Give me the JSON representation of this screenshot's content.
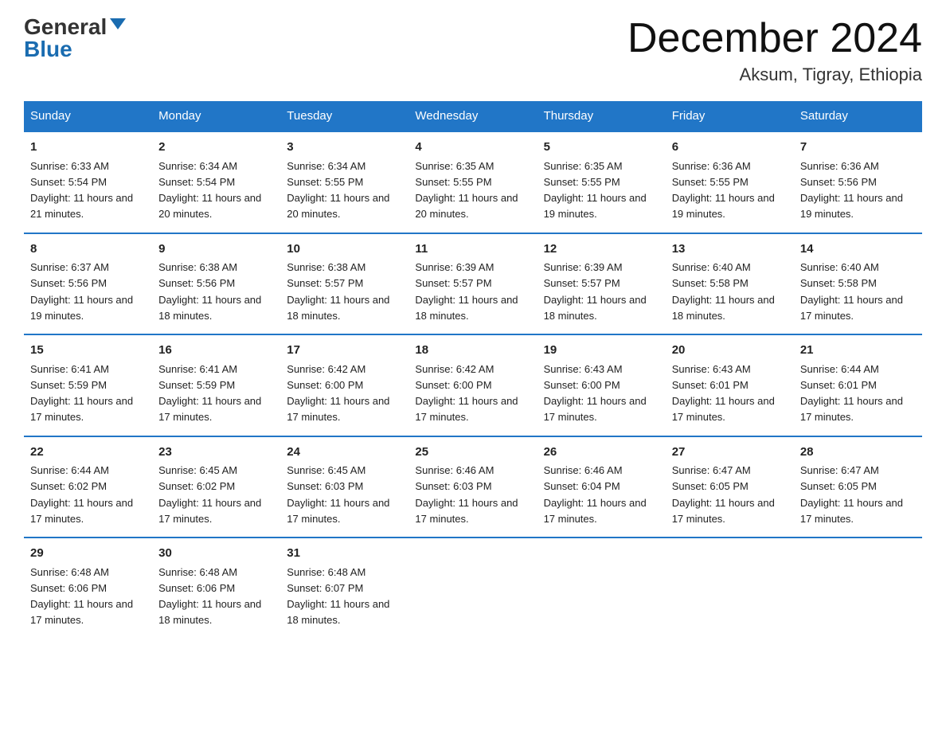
{
  "logo": {
    "general": "General",
    "blue": "Blue"
  },
  "title": "December 2024",
  "location": "Aksum, Tigray, Ethiopia",
  "days_of_week": [
    "Sunday",
    "Monday",
    "Tuesday",
    "Wednesday",
    "Thursday",
    "Friday",
    "Saturday"
  ],
  "weeks": [
    [
      {
        "day": "1",
        "sunrise": "6:33 AM",
        "sunset": "5:54 PM",
        "daylight": "11 hours and 21 minutes."
      },
      {
        "day": "2",
        "sunrise": "6:34 AM",
        "sunset": "5:54 PM",
        "daylight": "11 hours and 20 minutes."
      },
      {
        "day": "3",
        "sunrise": "6:34 AM",
        "sunset": "5:55 PM",
        "daylight": "11 hours and 20 minutes."
      },
      {
        "day": "4",
        "sunrise": "6:35 AM",
        "sunset": "5:55 PM",
        "daylight": "11 hours and 20 minutes."
      },
      {
        "day": "5",
        "sunrise": "6:35 AM",
        "sunset": "5:55 PM",
        "daylight": "11 hours and 19 minutes."
      },
      {
        "day": "6",
        "sunrise": "6:36 AM",
        "sunset": "5:55 PM",
        "daylight": "11 hours and 19 minutes."
      },
      {
        "day": "7",
        "sunrise": "6:36 AM",
        "sunset": "5:56 PM",
        "daylight": "11 hours and 19 minutes."
      }
    ],
    [
      {
        "day": "8",
        "sunrise": "6:37 AM",
        "sunset": "5:56 PM",
        "daylight": "11 hours and 19 minutes."
      },
      {
        "day": "9",
        "sunrise": "6:38 AM",
        "sunset": "5:56 PM",
        "daylight": "11 hours and 18 minutes."
      },
      {
        "day": "10",
        "sunrise": "6:38 AM",
        "sunset": "5:57 PM",
        "daylight": "11 hours and 18 minutes."
      },
      {
        "day": "11",
        "sunrise": "6:39 AM",
        "sunset": "5:57 PM",
        "daylight": "11 hours and 18 minutes."
      },
      {
        "day": "12",
        "sunrise": "6:39 AM",
        "sunset": "5:57 PM",
        "daylight": "11 hours and 18 minutes."
      },
      {
        "day": "13",
        "sunrise": "6:40 AM",
        "sunset": "5:58 PM",
        "daylight": "11 hours and 18 minutes."
      },
      {
        "day": "14",
        "sunrise": "6:40 AM",
        "sunset": "5:58 PM",
        "daylight": "11 hours and 17 minutes."
      }
    ],
    [
      {
        "day": "15",
        "sunrise": "6:41 AM",
        "sunset": "5:59 PM",
        "daylight": "11 hours and 17 minutes."
      },
      {
        "day": "16",
        "sunrise": "6:41 AM",
        "sunset": "5:59 PM",
        "daylight": "11 hours and 17 minutes."
      },
      {
        "day": "17",
        "sunrise": "6:42 AM",
        "sunset": "6:00 PM",
        "daylight": "11 hours and 17 minutes."
      },
      {
        "day": "18",
        "sunrise": "6:42 AM",
        "sunset": "6:00 PM",
        "daylight": "11 hours and 17 minutes."
      },
      {
        "day": "19",
        "sunrise": "6:43 AM",
        "sunset": "6:00 PM",
        "daylight": "11 hours and 17 minutes."
      },
      {
        "day": "20",
        "sunrise": "6:43 AM",
        "sunset": "6:01 PM",
        "daylight": "11 hours and 17 minutes."
      },
      {
        "day": "21",
        "sunrise": "6:44 AM",
        "sunset": "6:01 PM",
        "daylight": "11 hours and 17 minutes."
      }
    ],
    [
      {
        "day": "22",
        "sunrise": "6:44 AM",
        "sunset": "6:02 PM",
        "daylight": "11 hours and 17 minutes."
      },
      {
        "day": "23",
        "sunrise": "6:45 AM",
        "sunset": "6:02 PM",
        "daylight": "11 hours and 17 minutes."
      },
      {
        "day": "24",
        "sunrise": "6:45 AM",
        "sunset": "6:03 PM",
        "daylight": "11 hours and 17 minutes."
      },
      {
        "day": "25",
        "sunrise": "6:46 AM",
        "sunset": "6:03 PM",
        "daylight": "11 hours and 17 minutes."
      },
      {
        "day": "26",
        "sunrise": "6:46 AM",
        "sunset": "6:04 PM",
        "daylight": "11 hours and 17 minutes."
      },
      {
        "day": "27",
        "sunrise": "6:47 AM",
        "sunset": "6:05 PM",
        "daylight": "11 hours and 17 minutes."
      },
      {
        "day": "28",
        "sunrise": "6:47 AM",
        "sunset": "6:05 PM",
        "daylight": "11 hours and 17 minutes."
      }
    ],
    [
      {
        "day": "29",
        "sunrise": "6:48 AM",
        "sunset": "6:06 PM",
        "daylight": "11 hours and 17 minutes."
      },
      {
        "day": "30",
        "sunrise": "6:48 AM",
        "sunset": "6:06 PM",
        "daylight": "11 hours and 18 minutes."
      },
      {
        "day": "31",
        "sunrise": "6:48 AM",
        "sunset": "6:07 PM",
        "daylight": "11 hours and 18 minutes."
      },
      null,
      null,
      null,
      null
    ]
  ]
}
